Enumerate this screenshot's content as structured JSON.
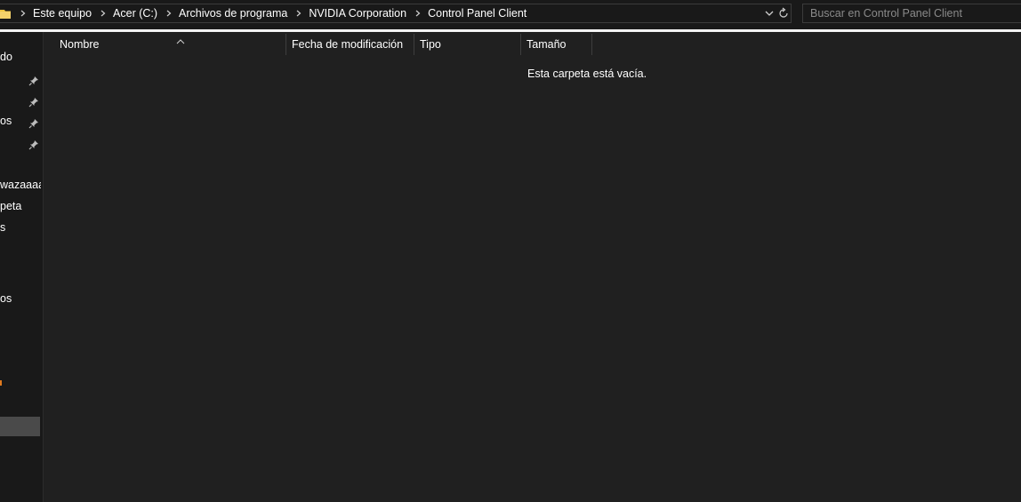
{
  "address": {
    "crumbs": [
      "Este equipo",
      "Acer (C:)",
      "Archivos de programa",
      "NVIDIA Corporation",
      "Control Panel Client"
    ]
  },
  "search": {
    "placeholder": "Buscar en Control Panel Client"
  },
  "nav": {
    "items": [
      {
        "label": "do",
        "pinned": false
      },
      {
        "label": "",
        "pinned": true
      },
      {
        "label": "",
        "pinned": true
      },
      {
        "label": "os",
        "pinned": true
      },
      {
        "label": "",
        "pinned": true
      },
      {
        "label": "wazaaaaa",
        "pinned": false
      },
      {
        "label": "peta",
        "pinned": false
      },
      {
        "label": "s",
        "pinned": false
      },
      {
        "label": "os",
        "pinned": false
      }
    ]
  },
  "columns": {
    "name": "Nombre",
    "modified": "Fecha de modificación",
    "type": "Tipo",
    "size": "Tamaño"
  },
  "content": {
    "empty_message": "Esta carpeta está vacía."
  },
  "colors": {
    "background": "#191919",
    "content_bg": "#202020",
    "folder_yellow": "#f0c542",
    "accent_orange": "#e07a1f",
    "selected_bg": "#4a4a4a"
  }
}
